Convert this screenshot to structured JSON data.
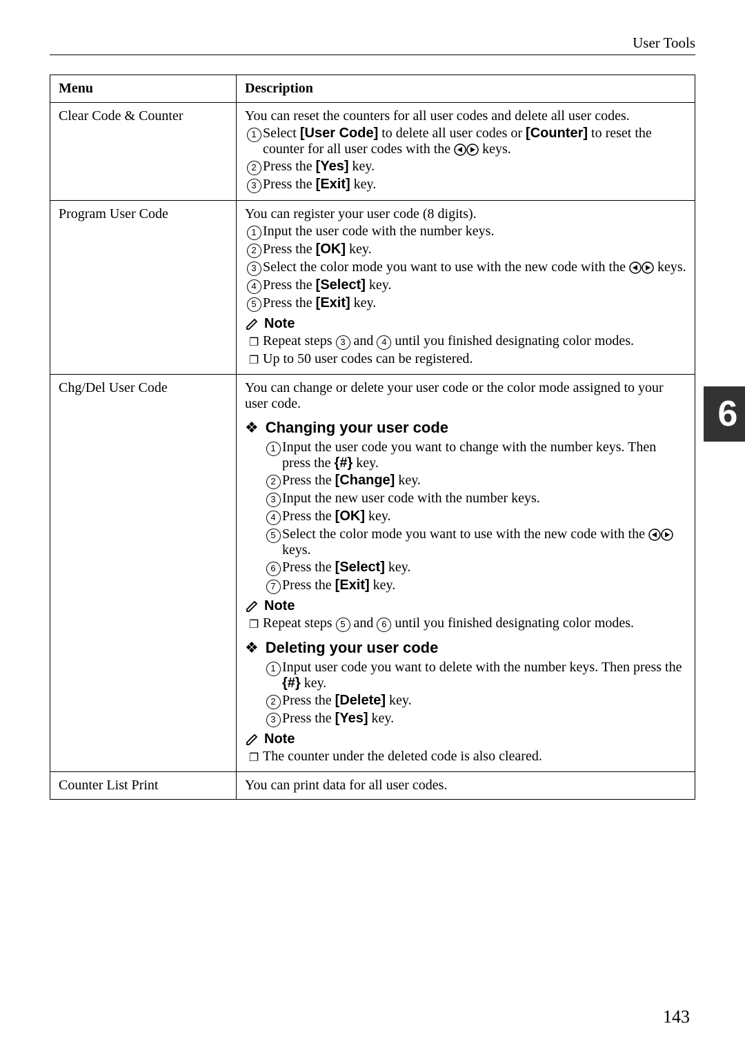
{
  "header": {
    "section": "User Tools"
  },
  "chapter_tab": "6",
  "page_number": "143",
  "table": {
    "headers": {
      "menu": "Menu",
      "description": "Description"
    },
    "rows": [
      {
        "menu": "Clear Code & Counter",
        "desc": {
          "intro": "You can reset the counters for all user codes and delete all user codes.",
          "steps": [
            {
              "n": "1",
              "pre": "Select ",
              "k1": "[User Code]",
              "mid": " to delete all user codes or ",
              "k2": "[Counter]",
              "post": " to reset the counter for all user codes with the ",
              "lrk": true,
              "tail": " keys."
            },
            {
              "n": "2",
              "pre": "Press the ",
              "k1": "[Yes]",
              "post": " key."
            },
            {
              "n": "3",
              "pre": "Press the ",
              "k1": "[Exit]",
              "post": " key."
            }
          ]
        }
      },
      {
        "menu": "Program User Code",
        "desc": {
          "intro": "You can register your user code (8 digits).",
          "steps": [
            {
              "n": "1",
              "pre": "Input the user code with the number keys."
            },
            {
              "n": "2",
              "pre": "Press the ",
              "k1": "[OK]",
              "post": " key."
            },
            {
              "n": "3",
              "pre": "Select the color mode you want to use with the new code with the ",
              "lrk": true,
              "tail": " keys."
            },
            {
              "n": "4",
              "pre": "Press the ",
              "k1": "[Select]",
              "post": " key."
            },
            {
              "n": "5",
              "pre": "Press the ",
              "k1": "[Exit]",
              "post": " key."
            }
          ],
          "note_label": "Note",
          "notes": [
            {
              "pre": "Repeat steps ",
              "c1": "3",
              "mid": " and ",
              "c2": "4",
              "post": " until you finished designating color modes."
            },
            {
              "pre": "Up to 50 user codes can be registered."
            }
          ]
        }
      },
      {
        "menu": "Chg/Del User Code",
        "desc": {
          "intro": "You can change or delete your user code or the color mode assigned to your user code.",
          "sub1": {
            "title": "Changing your user code",
            "steps": [
              {
                "n": "1",
                "pre": "Input the user code you want to change with the number keys. Then press the ",
                "bracket_hash": true,
                "post": " key."
              },
              {
                "n": "2",
                "pre": "Press the ",
                "k1": "[Change]",
                "post": " key."
              },
              {
                "n": "3",
                "pre": "Input the new user code with the number keys."
              },
              {
                "n": "4",
                "pre": "Press the ",
                "k1": "[OK]",
                "post": " key."
              },
              {
                "n": "5",
                "pre": "Select the color mode you want to use with the new code with the ",
                "lrk": true,
                "tail": " keys."
              },
              {
                "n": "6",
                "pre": "Press the ",
                "k1": "[Select]",
                "post": " key."
              },
              {
                "n": "7",
                "pre": "Press the ",
                "k1": "[Exit]",
                "post": " key."
              }
            ],
            "note_label": "Note",
            "notes": [
              {
                "pre": "Repeat steps ",
                "c1": "5",
                "mid": " and ",
                "c2": "6",
                "post": " until you finished designating color modes."
              }
            ]
          },
          "sub2": {
            "title": "Deleting your user code",
            "steps": [
              {
                "n": "1",
                "pre": "Input user code you want to delete with the number keys. Then press the ",
                "bracket_hash": true,
                "post": " key."
              },
              {
                "n": "2",
                "pre": "Press the ",
                "k1": "[Delete]",
                "post": " key."
              },
              {
                "n": "3",
                "pre": "Press the ",
                "k1": "[Yes]",
                "post": " key."
              }
            ],
            "note_label": "Note",
            "notes": [
              {
                "pre": "The counter under the deleted code is also cleared."
              }
            ]
          }
        }
      },
      {
        "menu": "Counter List Print",
        "desc": {
          "intro": "You can print data for all user codes."
        }
      }
    ]
  }
}
